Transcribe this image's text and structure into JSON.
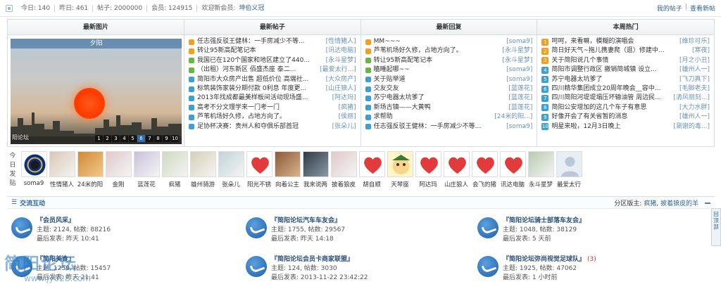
{
  "stats": {
    "today_label": "今日: 140",
    "yesterday_label": "昨日: 461",
    "posts_label": "帖子: 2000000",
    "members_label": "会员: 124915",
    "welcome_label": "欢迎新会员:",
    "new_member": "坤伯义冠",
    "my_posts": "我的帖子",
    "new_posts": "查看新帖"
  },
  "portal": {
    "latest_images": {
      "heading": "最新图片",
      "image_title": "夕阳",
      "caption": "阳论坛",
      "pager": [
        "1",
        "2",
        "3",
        "4",
        "5",
        "6",
        "7",
        "8",
        "9",
        "10"
      ],
      "active_page": "6"
    },
    "latest_threads": {
      "heading": "最新帖子",
      "items": [
        {
          "title": "任志强反驳王健林：一手房减少不等...",
          "author": "[性情猪人]",
          "color": "#f0a020"
        },
        {
          "title": "转让95新高配笔记本",
          "author": "[讯达电脑]",
          "color": "#f0a020"
        },
        {
          "title": "我国已在120个国家和地区建立了440...",
          "author": "[永斗星梦]",
          "color": "#69b646"
        },
        {
          "title": "（出租）河东新区 佰盛杰座 泰二...",
          "author": "[最爱太行...]",
          "color": "#69b646"
        },
        {
          "title": "简阳市大众房产出售 超低价位 高端社...",
          "author": "[大众房产]",
          "color": "#3ea0cf"
        },
        {
          "title": "标筑装饰家装分期付款 0利息 年度更...",
          "author": "[山庄狼人]",
          "color": "#3ea0cf"
        },
        {
          "title": "2013年找成都最美样板间活动现场盛...",
          "author": "[阿达玛]",
          "color": "#3ea0cf"
        },
        {
          "title": "高考不分文理学来一门考一门",
          "author": "[疯猪]",
          "color": "#3ea0cf"
        },
        {
          "title": "芦苇机场好久修，占地方向了。",
          "author": "[侯丽]",
          "color": "#3ea0cf"
        },
        {
          "title": "足协杯决赛：贵州人和夺俱乐部首冠",
          "author": "[张朵儿]",
          "color": "#3ea0cf"
        }
      ]
    },
    "latest_replies": {
      "heading": "最新回复",
      "items": [
        {
          "title": "MM~~~",
          "author": "[soma9]",
          "color": "#f0a020"
        },
        {
          "title": "芦苇机场好久修，占地方向了。",
          "author": "[永斗星梦]",
          "color": "#f0a020"
        },
        {
          "title": "转让95新高配笔记本",
          "author": "[永斗星梦]",
          "color": "#69b646"
        },
        {
          "title": "瞌睡起哪~~",
          "author": "[soma9]",
          "color": "#69b646"
        },
        {
          "title": "关于贴举道",
          "author": "[soma9]",
          "color": "#3ea0cf"
        },
        {
          "title": "交友交友",
          "author": "[蓝莲花]",
          "color": "#3ea0cf"
        },
        {
          "title": "苏宁电器太坑爹了",
          "author": "[蓝莲花]",
          "color": "#3ea0cf"
        },
        {
          "title": "新场古镇——大黄鸭",
          "author": "[蓝莲花]",
          "color": "#3ea0cf"
        },
        {
          "title": "求帮助",
          "author": "[24米的阳...]",
          "color": "#3ea0cf"
        },
        {
          "title": "任志强反驳王健林：一手房减少不等...",
          "author": "[soma9]",
          "color": "#3ea0cf"
        }
      ]
    },
    "weekly_hot": {
      "heading": "本周热门",
      "items": [
        {
          "num": "1",
          "title": "呵呵，来看嘛，模糊的演唱会",
          "author": "[维珍可乐]",
          "color": "#f0a020"
        },
        {
          "num": "2",
          "title": "简日好天气~拖儿携妻爬（逛）修建中...",
          "author": "[寒夜]",
          "color": "#f0a020"
        },
        {
          "num": "3",
          "title": "关于简阳说几个事情",
          "author": "[月之小丑]",
          "color": "#f0a020"
        },
        {
          "num": "4",
          "title": "简阳市调整行政区 撤销简城镇 设立...",
          "author": "[雄州人一]",
          "color": "#3ea0cf"
        },
        {
          "num": "5",
          "title": "苏宁电器太坑爹了",
          "author": "[飞刀真下]",
          "color": "#3ea0cf"
        },
        {
          "num": "6",
          "title": "四川精华集团成立20周年晚会__容中...",
          "author": "[毛脚老夫]",
          "color": "#3ea0cf"
        },
        {
          "num": "7",
          "title": "四川简阳河堤堤塌压坏输油管 周边民...",
          "author": "[清风丽刻...]",
          "color": "#3ea0cf"
        },
        {
          "num": "8",
          "title": "简阳公安增加的这几个车子有意思",
          "author": "[大力水胖]",
          "color": "#3ea0cf"
        },
        {
          "num": "9",
          "title": "好像开会了有关省暂的消息",
          "author": "[雄州人一]",
          "color": "#3ea0cf"
        },
        {
          "num": "10",
          "title": "明星来啦，12月3日晚上",
          "author": "[涮谢的毒...]",
          "color": "#3ea0cf"
        }
      ]
    }
  },
  "today_posters": {
    "label": "今日发贴",
    "members": [
      {
        "name": "soma9",
        "avatar": "inter-logo-icon"
      },
      {
        "name": "性情猪人",
        "avatar": "photo"
      },
      {
        "name": "24米的阳",
        "avatar": "tiger-icon"
      },
      {
        "name": "金刚",
        "avatar": "photo"
      },
      {
        "name": "蓝莲花",
        "avatar": "photo"
      },
      {
        "name": "疯猪",
        "avatar": "photo"
      },
      {
        "name": "雄州骑游",
        "avatar": "photo"
      },
      {
        "name": "张朵儿",
        "avatar": "photo"
      },
      {
        "name": "阳光不锈",
        "avatar": "heart-icon"
      },
      {
        "name": "向着公主",
        "avatar": "dog-icon"
      },
      {
        "name": "我来说两",
        "avatar": "horse-icon"
      },
      {
        "name": "披着狼皮",
        "avatar": "photo"
      },
      {
        "name": "胡自顺",
        "avatar": "heart-icon"
      },
      {
        "name": "天琴座",
        "avatar": "cartoon-icon"
      },
      {
        "name": "阿达玛",
        "avatar": "heart-icon"
      },
      {
        "name": "山庄狼人",
        "avatar": "heart-icon"
      },
      {
        "name": "会飞的猪",
        "avatar": "heart-icon"
      },
      {
        "name": "讯达电脑",
        "avatar": "heart-icon"
      },
      {
        "name": "永斗星梦",
        "avatar": "photo"
      },
      {
        "name": "最爱太行",
        "avatar": "default-avatar-icon"
      }
    ]
  },
  "section": {
    "title": "交流互动",
    "moderators_label": "分区版主:",
    "moderators": [
      "疯猪",
      "披着狼皮的羊"
    ],
    "moderator_sep": ","
  },
  "forums": [
    {
      "name": "『会员风采』",
      "stats": "主题: 2124, 帖数: 88216",
      "last": "最后发表: 昨天 10:41",
      "badge": ""
    },
    {
      "name": "『简阳论坛汽车车友会』",
      "stats": "主题: 1755, 帖数: 29567",
      "last": "最后发表: 昨天 14:18",
      "badge": ""
    },
    {
      "name": "『简阳论坛骑士部落车友会』",
      "stats": "主题: 1048, 帖数: 38129",
      "last": "最后发表: 5 天前",
      "badge": ""
    },
    {
      "name": "『简阳美食』",
      "stats": "主题: 1259, 帖数: 15457",
      "last": "最后发表: 昨天 21:41",
      "badge": ""
    },
    {
      "name": "『简阳论坛会员卡商家联盟』",
      "stats": "主题: 124, 帖数: 3030",
      "last": "最后发表: 2013-11-22 23:42:22",
      "badge": ""
    },
    {
      "name": "『简阳论坛弥尚视觉足球队』",
      "stats": "主题: 1925, 帖数: 47062",
      "last": "最后发表: 1 小时前",
      "badge": "(3)"
    }
  ],
  "side_button": "回顶部",
  "watermark": {
    "text": "简阳论坛",
    "url": "www.jy028.com"
  }
}
